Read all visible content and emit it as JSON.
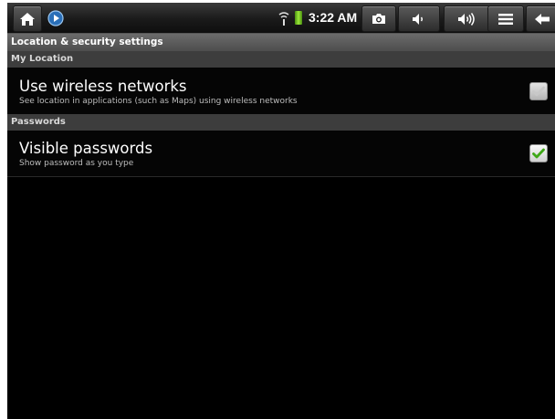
{
  "status_bar": {
    "time": "3:22 AM",
    "icons": [
      "home-icon",
      "play-icon",
      "wifi-icon",
      "battery-icon",
      "camera-icon",
      "volume-down-icon",
      "volume-up-icon",
      "menu-icon",
      "back-icon"
    ]
  },
  "header": {
    "title": "Location & security settings"
  },
  "sections": [
    {
      "label": "My Location",
      "items": [
        {
          "title": "Use wireless networks",
          "summary": "See location in applications (such as Maps) using wireless networks",
          "checked": true,
          "enabled": false
        }
      ]
    },
    {
      "label": "Passwords",
      "items": [
        {
          "title": "Visible passwords",
          "summary": "Show password as you type",
          "checked": true,
          "enabled": true
        }
      ]
    }
  ],
  "colors": {
    "check_green": "#3fa818",
    "check_disabled": "#c8c8c8",
    "section_bg": "#3d3d3d",
    "header_bg": "#5a5a5a"
  }
}
